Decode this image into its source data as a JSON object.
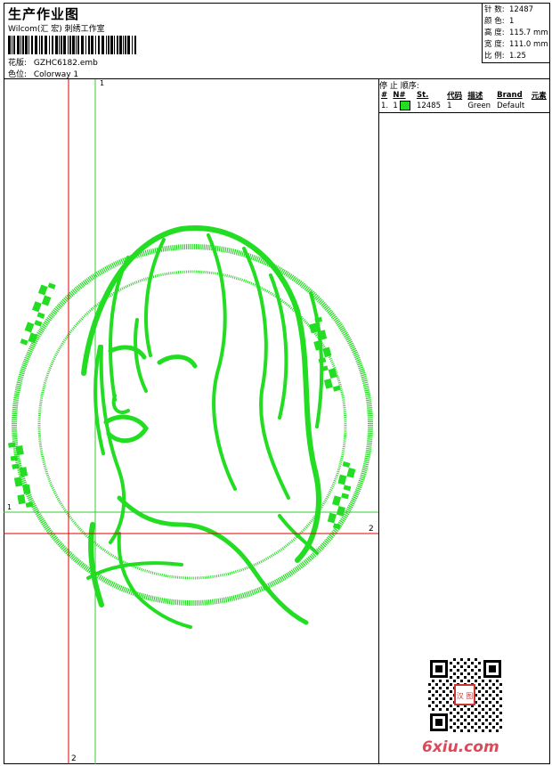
{
  "header": {
    "title": "生产作业图",
    "company": "Wilcom(汇 宏) 刺绣工作室",
    "design_label": "花版:",
    "design_value": "GZHC6182.emb",
    "colorway_label": "色位:",
    "colorway_value": "Colorway 1"
  },
  "stats": [
    {
      "label": "针 数:",
      "value": "12487"
    },
    {
      "label": "颜 色:",
      "value": "1"
    },
    {
      "label": "高 度:",
      "value": "115.7 mm"
    },
    {
      "label": "宽 度:",
      "value": "111.0 mm"
    },
    {
      "label": "比 例:",
      "value": "1.25"
    }
  ],
  "stop_sequence": {
    "title": "停 止 顺序:",
    "columns": [
      "#",
      "N#",
      "St.",
      "代码",
      "描述",
      "Brand",
      "元素"
    ],
    "rows": [
      {
        "num": "1.",
        "n": "1",
        "stitches": "12485",
        "code": "1",
        "desc": "Green",
        "brand": "Default",
        "color": "#22dd22"
      }
    ]
  },
  "guides": {
    "vertical_red_label": "2",
    "vertical_green_label": "1",
    "horizontal_green_label": "1",
    "horizontal_red_label": "2"
  },
  "colors": {
    "stitch": "#22dd22",
    "guide_red": "#dd0000",
    "guide_green": "#33cc33"
  },
  "watermark": "6xiu.com",
  "qr_stamp_text": "汉 图"
}
